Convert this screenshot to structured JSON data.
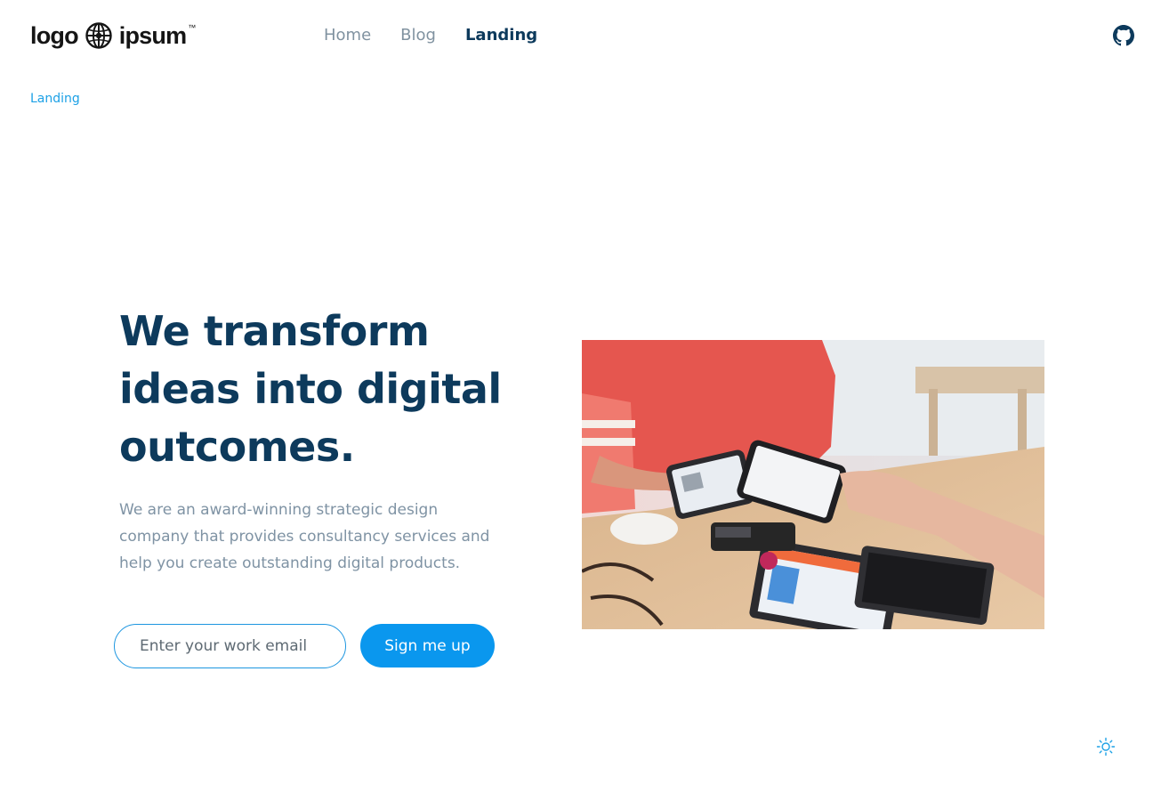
{
  "brand": {
    "logo_word_1": "logo",
    "logo_word_2": "ipsum",
    "logo_mark": "globe-icon",
    "logo_tm": "™"
  },
  "nav": {
    "items": [
      {
        "label": "Home",
        "active": false
      },
      {
        "label": "Blog",
        "active": false
      },
      {
        "label": "Landing",
        "active": true
      }
    ],
    "github_icon": "github-icon"
  },
  "breadcrumb": {
    "label": "Landing"
  },
  "hero": {
    "title": "We transform ideas into digital outcomes.",
    "description": "We are an award-winning strategic design company that provides consultancy services and help you create outstanding digital products.",
    "email_placeholder": "Enter your work email",
    "email_value": "",
    "cta_label": "Sign me up",
    "image_icon": "payment-photo"
  },
  "theme_toggle": {
    "icon": "sun-icon"
  },
  "colors": {
    "primary_dark": "#0d3a5c",
    "accent": "#0a97ee",
    "link": "#1da1e6",
    "muted_text": "#7f93a4",
    "nav_inactive": "#8092a0"
  }
}
